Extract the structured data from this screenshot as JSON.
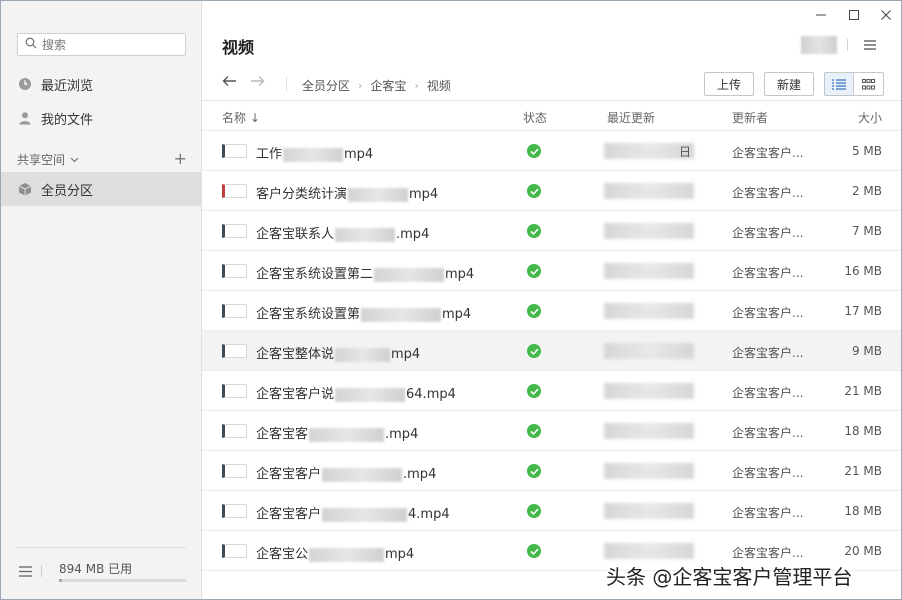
{
  "sidebar": {
    "search_placeholder": "搜索",
    "items": [
      {
        "label": "最近浏览",
        "icon": "clock-icon"
      },
      {
        "label": "我的文件",
        "icon": "user-icon"
      }
    ],
    "shared_header": "共享空间",
    "shared_items": [
      {
        "label": "全员分区",
        "icon": "cube-icon"
      }
    ],
    "storage_text": "894 MB 已用",
    "storage_fraction": 0.02
  },
  "header": {
    "title": "视频"
  },
  "toolbar": {
    "breadcrumbs": [
      "全员分区",
      "企客宝",
      "视频"
    ],
    "upload_label": "上传",
    "new_label": "新建",
    "view_mode": "list"
  },
  "table": {
    "columns": {
      "name": "名称",
      "status": "状态",
      "updated": "最近更新",
      "updater": "更新者",
      "size": "大小"
    },
    "rows": [
      {
        "name_prefix": "工作",
        "name_suffix": "mp4",
        "updater": "企客宝客户...",
        "size": "5 MB",
        "date_tail": "日"
      },
      {
        "name_prefix": "客户分类统计演",
        "name_suffix": "mp4",
        "updater": "企客宝客户...",
        "size": "2 MB",
        "date_tail": ""
      },
      {
        "name_prefix": "企客宝联系人",
        "name_suffix": ".mp4",
        "updater": "企客宝客户...",
        "size": "7 MB",
        "date_tail": ""
      },
      {
        "name_prefix": "企客宝系统设置第二",
        "name_suffix": "mp4",
        "updater": "企客宝客户...",
        "size": "16 MB",
        "date_tail": ""
      },
      {
        "name_prefix": "企客宝系统设置第",
        "name_suffix": "mp4",
        "updater": "企客宝客户...",
        "size": "17 MB",
        "date_tail": ""
      },
      {
        "name_prefix": "企客宝整体说",
        "name_suffix": "mp4",
        "updater": "企客宝客户...",
        "size": "9 MB",
        "date_tail": ""
      },
      {
        "name_prefix": "企客宝客户说",
        "name_suffix": "64.mp4",
        "updater": "企客宝客户...",
        "size": "21 MB",
        "date_tail": ""
      },
      {
        "name_prefix": "企客宝客",
        "name_suffix": ".mp4",
        "updater": "企客宝客户...",
        "size": "18 MB",
        "date_tail": ""
      },
      {
        "name_prefix": "企客宝客户",
        "name_suffix": ".mp4",
        "updater": "企客宝客户...",
        "size": "21 MB",
        "date_tail": ""
      },
      {
        "name_prefix": "企客宝客户",
        "name_suffix": "4.mp4",
        "updater": "企客宝客户...",
        "size": "18 MB",
        "date_tail": ""
      },
      {
        "name_prefix": "企客宝公",
        "name_suffix": "mp4",
        "updater": "企客宝客户...",
        "size": "20 MB",
        "date_tail": ""
      }
    ]
  },
  "watermark": "头条 @企客宝客户管理平台",
  "colors": {
    "status_ok": "#43b94b",
    "sidebar_bg": "#f3f3f3",
    "active_item": "#dedede"
  }
}
